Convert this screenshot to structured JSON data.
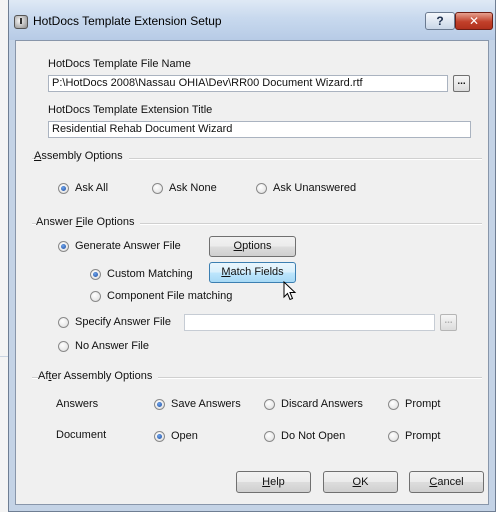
{
  "window": {
    "title": "HotDocs Template Extension Setup",
    "help_glyph": "?",
    "close_glyph": "✕"
  },
  "template_file": {
    "label": "HotDocs Template File Name",
    "value": "P:\\HotDocs 2008\\Nassau OHIA\\Dev\\RR00 Document Wizard.rtf",
    "browse": "..."
  },
  "extension_title": {
    "label": "HotDocs Template Extension Title",
    "value": "Residential Rehab Document Wizard"
  },
  "assembly": {
    "group_label": {
      "a": "A",
      "rest": "ssembly Options"
    },
    "options": [
      {
        "label": "Ask All",
        "selected": true
      },
      {
        "label": "Ask None",
        "selected": false
      },
      {
        "label": "Ask Unanswered",
        "selected": false
      }
    ]
  },
  "answer_file": {
    "group_label": {
      "pre": "Answer ",
      "u": "F",
      "rest": "ile Options"
    },
    "generate_label": "Generate Answer File",
    "options_button": {
      "u": "O",
      "rest": "ptions"
    },
    "custom_matching_label": "Custom Matching",
    "match_fields_button": {
      "u": "M",
      "rest": "atch Fields"
    },
    "component_matching_label": "Component File matching",
    "specify_label": "Specify Answer File",
    "specify_browse": "...",
    "no_answer_label": "No Answer File"
  },
  "after_assembly": {
    "group_label": {
      "pre": "Af",
      "u": "t",
      "rest": "er Assembly Options"
    },
    "answers": {
      "label": "Answers",
      "options": [
        {
          "label": "Save Answers",
          "selected": true
        },
        {
          "label": "Discard Answers",
          "selected": false
        },
        {
          "label": "Prompt",
          "selected": false
        }
      ]
    },
    "document": {
      "label": "Document",
      "options": [
        {
          "label": "Open",
          "selected": true
        },
        {
          "label": "Do Not Open",
          "selected": false
        },
        {
          "label": "Prompt",
          "selected": false
        }
      ]
    }
  },
  "buttons": {
    "help": {
      "u": "H",
      "rest": "elp"
    },
    "ok": {
      "u": "O",
      "rest": "K"
    },
    "cancel": {
      "u": "C",
      "rest": "ancel"
    }
  },
  "colors": {
    "accent": "#3c7fb1",
    "close": "#c1402a"
  }
}
